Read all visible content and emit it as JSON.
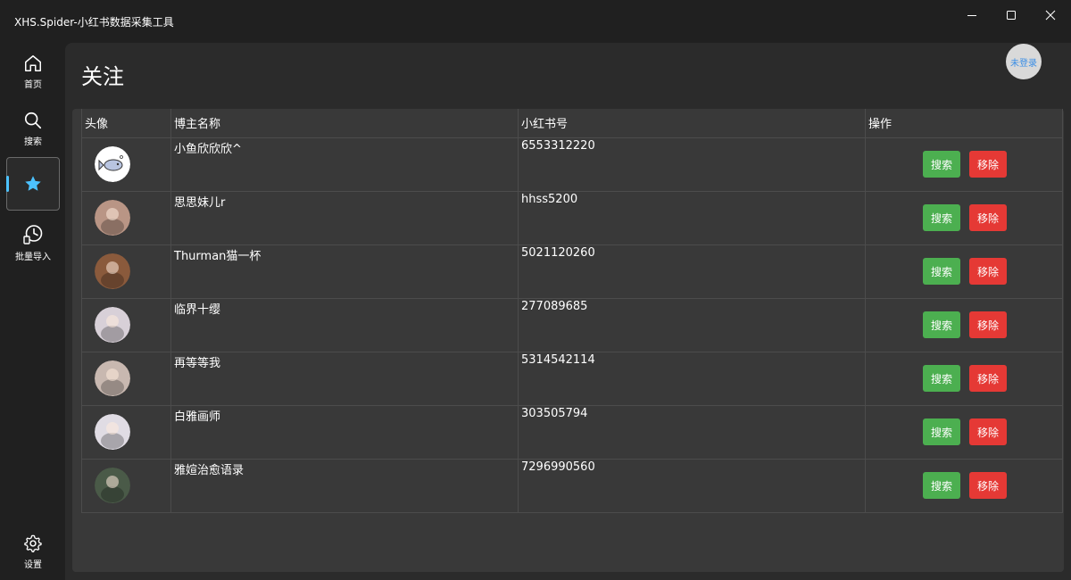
{
  "window": {
    "title": "XHS.Spider-小红书数据采集工具"
  },
  "nav": {
    "items": [
      {
        "label": "首页",
        "icon": "home-icon"
      },
      {
        "label": "搜索",
        "icon": "search-icon"
      },
      {
        "label": "",
        "icon": "star-icon",
        "active": true
      },
      {
        "label": "批量导入",
        "icon": "batch-import-icon"
      },
      {
        "label": "设置",
        "icon": "gear-icon"
      }
    ]
  },
  "header": {
    "title": "关注",
    "login_status": "未登录"
  },
  "table": {
    "columns": [
      "头像",
      "博主名称",
      "小红书号",
      "操作"
    ],
    "rows": [
      {
        "name": "小鱼欣欣欣^",
        "xhs_id": "6553312220",
        "avatar_color": "#ffffff"
      },
      {
        "name": "思思妹儿r",
        "xhs_id": "hhss5200",
        "avatar_color": "#b99585"
      },
      {
        "name": "Thurman猫一杯",
        "xhs_id": "5021120260",
        "avatar_color": "#8a5a3c"
      },
      {
        "name": "临界十缨",
        "xhs_id": "277089685",
        "avatar_color": "#d8d0d8"
      },
      {
        "name": "再等等我",
        "xhs_id": "5314542114",
        "avatar_color": "#c8b8b0"
      },
      {
        "name": "白雅画师",
        "xhs_id": "303505794",
        "avatar_color": "#e0dce4"
      },
      {
        "name": "雅媗治愈语录",
        "xhs_id": "7296990560",
        "avatar_color": "#4a5a48"
      }
    ],
    "search_label": "搜索",
    "remove_label": "移除"
  },
  "colors": {
    "accent": "#4cc2ff",
    "search_button": "#4caf50",
    "remove_button": "#e53935"
  }
}
